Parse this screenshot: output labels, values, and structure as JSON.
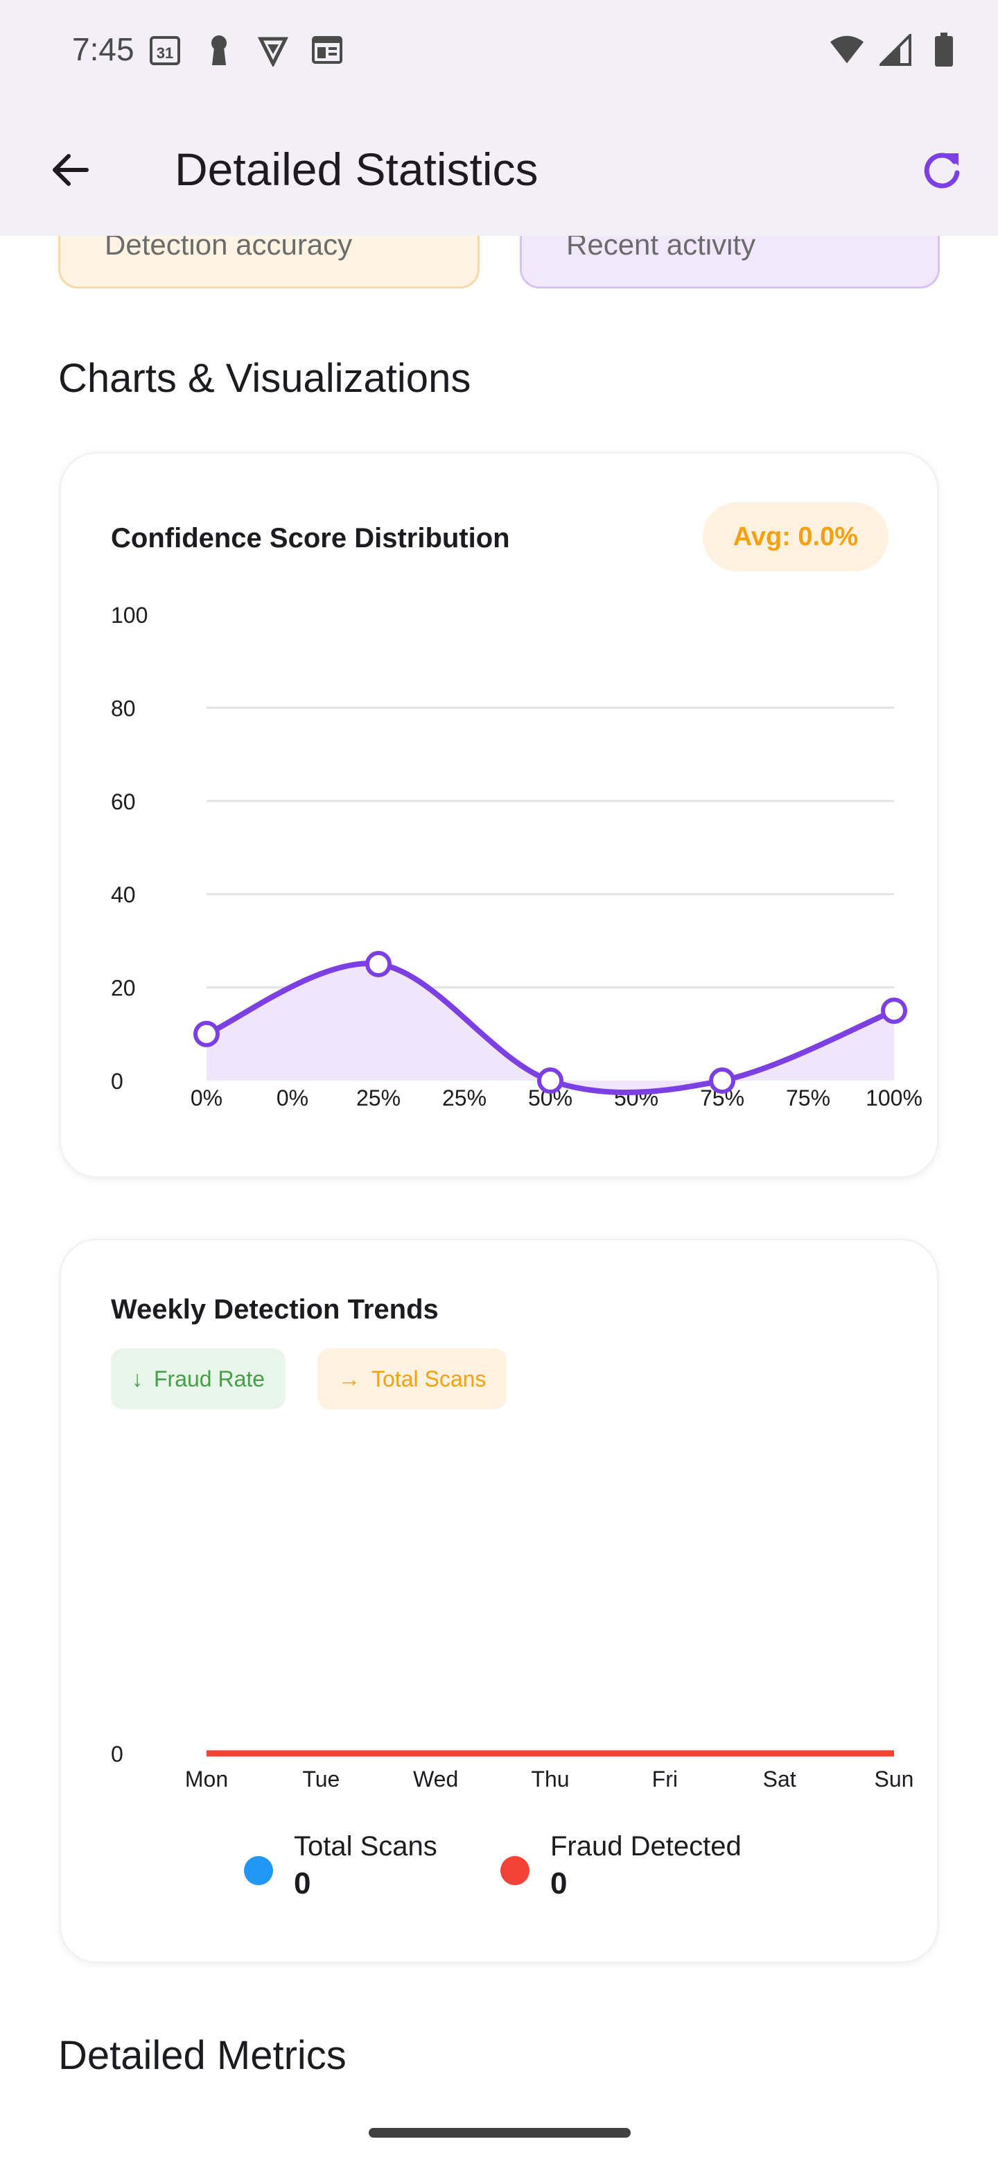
{
  "status_bar": {
    "time": "7:45",
    "calendar_day": "31",
    "icons": [
      "calendar-icon",
      "keyhole-icon",
      "vpn-shield-icon",
      "news-icon",
      "wifi-icon",
      "signal-icon",
      "battery-icon"
    ]
  },
  "app_bar": {
    "title": "Detailed Statistics",
    "back_icon": "arrow-back-icon",
    "refresh_icon": "refresh-icon"
  },
  "peek_cards": [
    {
      "label": "Detection accuracy"
    },
    {
      "label": "Recent activity"
    }
  ],
  "sections": {
    "charts_title": "Charts & Visualizations",
    "metrics_title": "Detailed Metrics"
  },
  "confidence_card": {
    "title": "Confidence Score Distribution",
    "avg_label": "Avg: 0.0%"
  },
  "weekly_card": {
    "title": "Weekly Detection Trends",
    "chips": [
      {
        "icon": "↓",
        "label": "Fraud Rate"
      },
      {
        "icon": "→",
        "label": "Total Scans"
      }
    ],
    "legend": [
      {
        "label": "Total Scans",
        "value": "0",
        "color": "#2196f3"
      },
      {
        "label": "Fraud Detected",
        "value": "0",
        "color": "#f44336"
      }
    ]
  },
  "colors": {
    "accent": "#7b3fe4",
    "area_fill": "#efe6fb",
    "orange": "#f5a10b",
    "green": "#43a047",
    "red": "#f44336",
    "blue": "#2196f3"
  },
  "chart_data": [
    {
      "type": "area",
      "title": "Confidence Score Distribution",
      "x": [
        "0%",
        "0%",
        "25%",
        "25%",
        "50%",
        "50%",
        "75%",
        "75%",
        "100%"
      ],
      "points": [
        {
          "x": "0%",
          "y": 10
        },
        {
          "x": "25%",
          "y": 25
        },
        {
          "x": "50%",
          "y": 0
        },
        {
          "x": "75%",
          "y": 0
        },
        {
          "x": "100%",
          "y": 15
        }
      ],
      "y_ticks": [
        0,
        20,
        40,
        60,
        80,
        100
      ],
      "ylim": [
        0,
        100
      ],
      "grid": true
    },
    {
      "type": "line",
      "title": "Weekly Detection Trends",
      "categories": [
        "Mon",
        "Tue",
        "Wed",
        "Thu",
        "Fri",
        "Sat",
        "Sun"
      ],
      "series": [
        {
          "name": "Total Scans",
          "values": [
            0,
            0,
            0,
            0,
            0,
            0,
            0
          ]
        },
        {
          "name": "Fraud Detected",
          "values": [
            0,
            0,
            0,
            0,
            0,
            0,
            0
          ]
        }
      ],
      "y_ticks": [
        0
      ]
    }
  ]
}
